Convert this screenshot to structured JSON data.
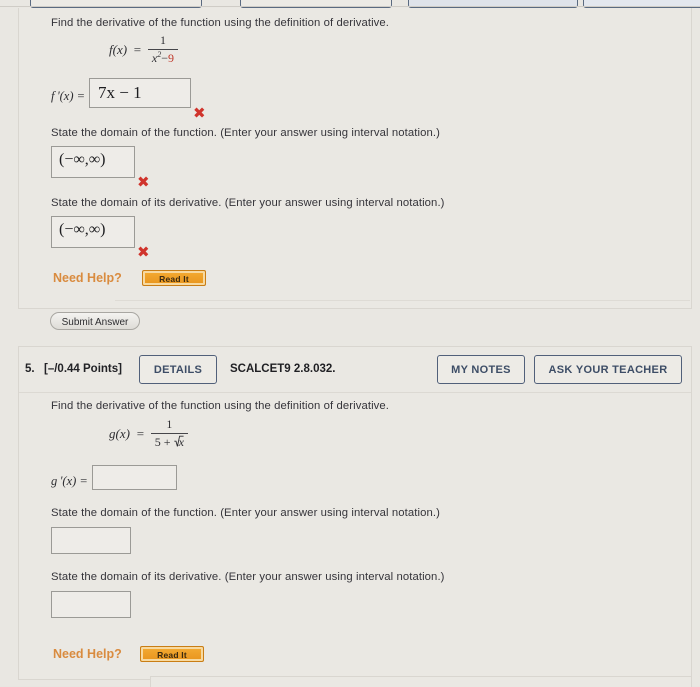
{
  "page": {
    "background_color": "#e9e7e2",
    "panel_color": "#eae8e3"
  },
  "top_partial_buttons": [
    "",
    "",
    "",
    ""
  ],
  "question4": {
    "prompt_main": "Find the derivative of the function using the definition of derivative.",
    "function": {
      "name": "f(x)",
      "equals": "=",
      "numerator": "1",
      "denominator_base": "x",
      "denominator_exponent": "2",
      "denominator_operator": "−",
      "denominator_constant": "9"
    },
    "derivative_label": "f '(x)  =",
    "derivative_answer": "7x − 1",
    "derivative_mark": "✖",
    "domain_function_prompt": "State the domain of the function. (Enter your answer using interval notation.)",
    "domain_function_answer": "(−∞,∞)",
    "domain_function_mark": "✖",
    "domain_derivative_prompt": "State the domain of its derivative. (Enter your answer using interval notation.)",
    "domain_derivative_answer": "(−∞,∞)",
    "domain_derivative_mark": "✖",
    "need_help_label": "Need Help?",
    "read_it_label": "Read It",
    "submit_label": "Submit Answer"
  },
  "question5": {
    "number": "5.",
    "points": "[–/0.44 Points]",
    "details_label": "DETAILS",
    "source_code": "SCALCET9 2.8.032.",
    "my_notes_label": "MY NOTES",
    "ask_teacher_label": "ASK YOUR TEACHER",
    "prompt_main": "Find the derivative of the function using the definition of derivative.",
    "function": {
      "name": "g(x)",
      "equals": "=",
      "numerator": "1",
      "denominator_constant": "5",
      "denominator_operator": "+",
      "denominator_radicand": "x"
    },
    "derivative_label": "g '(x)  =",
    "derivative_answer": "",
    "domain_function_prompt": "State the domain of the function. (Enter your answer using interval notation.)",
    "domain_function_answer": "",
    "domain_derivative_prompt": "State the domain of its derivative. (Enter your answer using interval notation.)",
    "domain_derivative_answer": "",
    "need_help_label": "Need Help?",
    "read_it_label": "Read It"
  }
}
